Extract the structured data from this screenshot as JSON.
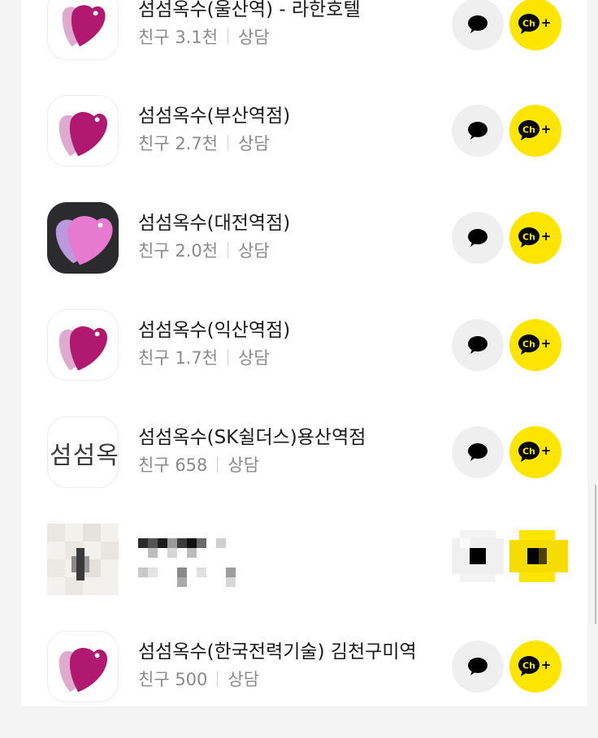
{
  "channels": [
    {
      "name": "섬섬옥수(울산역) - 라한호텔",
      "friends": "친구 3.1천",
      "status": "상담",
      "logo": "heart-logo"
    },
    {
      "name": "섬섬옥수(부산역점)",
      "friends": "친구 2.7천",
      "status": "상담",
      "logo": "heart-logo"
    },
    {
      "name": "섬섬옥수(대전역점)",
      "friends": "친구 2.0천",
      "status": "상담",
      "logo": "heart-logo-dark"
    },
    {
      "name": "섬섬옥수(익산역점)",
      "friends": "친구 1.7천",
      "status": "상담",
      "logo": "heart-logo"
    },
    {
      "name": "섬섬옥수(SK쉴더스)용산역점",
      "friends": "친구 658",
      "status": "상담",
      "logo": "text-logo",
      "logo_text": "섬섬옥"
    },
    {
      "name": "섬섬옥수(한국전력기술) 김천구미역",
      "friends": "친구 500",
      "status": "상담",
      "logo": "heart-logo"
    }
  ],
  "buttons": {
    "channel_add_label": "Ch",
    "channel_add_plus": "+"
  },
  "colors": {
    "heart_magenta": "#b0196f",
    "heart_pink": "#d89bc6",
    "kakao_yellow": "#fee500"
  }
}
